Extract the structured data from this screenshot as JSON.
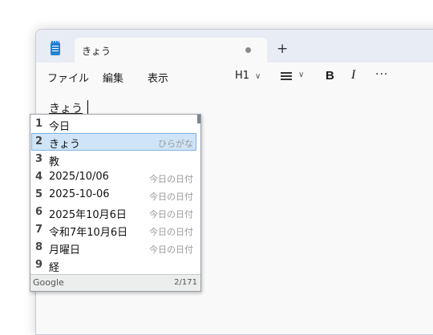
{
  "tab": {
    "title": "きょう",
    "new_tab": "+"
  },
  "menu": {
    "file": "ファイル",
    "edit": "編集",
    "view": "表示"
  },
  "toolbar": {
    "heading": "H1",
    "bold": "B",
    "italic": "I",
    "more": "···"
  },
  "editor": {
    "text": "きょう"
  },
  "ime": {
    "candidates": [
      {
        "num": "1",
        "text": "今日",
        "note": ""
      },
      {
        "num": "2",
        "text": "きょう",
        "note": "ひらがな"
      },
      {
        "num": "3",
        "text": "教",
        "note": ""
      },
      {
        "num": "4",
        "text": "2025/10/06",
        "note": "今日の日付"
      },
      {
        "num": "5",
        "text": "2025-10-06",
        "note": "今日の日付"
      },
      {
        "num": "6",
        "text": "2025年10月6日",
        "note": "今日の日付"
      },
      {
        "num": "7",
        "text": "令和7年10月6日",
        "note": "今日の日付"
      },
      {
        "num": "8",
        "text": "月曜日",
        "note": "今日の日付"
      },
      {
        "num": "9",
        "text": "経",
        "note": ""
      }
    ],
    "selected_index": 2,
    "brand": "Google",
    "count": "2/171"
  },
  "colors": {
    "selection": "#cfe4f7",
    "app_icon": "#1f82d0"
  }
}
